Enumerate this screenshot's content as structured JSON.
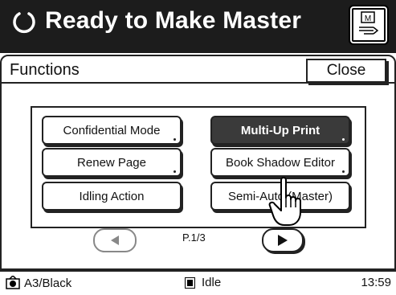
{
  "header": {
    "title": "Ready to Make Master",
    "status_icon": "refresh-icon",
    "master_button_icon": "master-feed-icon",
    "master_button_label": "M"
  },
  "panel": {
    "title": "Functions",
    "close_label": "Close"
  },
  "functions": [
    {
      "label": "Confidential Mode",
      "active": false
    },
    {
      "label": "Multi-Up Print",
      "active": true
    },
    {
      "label": "Renew Page",
      "active": false
    },
    {
      "label": "Book Shadow Editor",
      "active": false
    },
    {
      "label": "Idling Action",
      "active": false
    },
    {
      "label": "Semi-Auto (Master)",
      "active": false
    }
  ],
  "pagination": {
    "indicator": "P.1/3",
    "prev_icon": "triangle-left-icon",
    "next_icon": "triangle-right-icon"
  },
  "status": {
    "paper": "A3/Black",
    "paper_icon": "drum-icon",
    "state": "Idle",
    "state_icon": "stop-square-icon",
    "time": "13:59"
  },
  "colors": {
    "header_bg": "#1c1c1c",
    "active_button_bg": "#3a3a3a"
  }
}
